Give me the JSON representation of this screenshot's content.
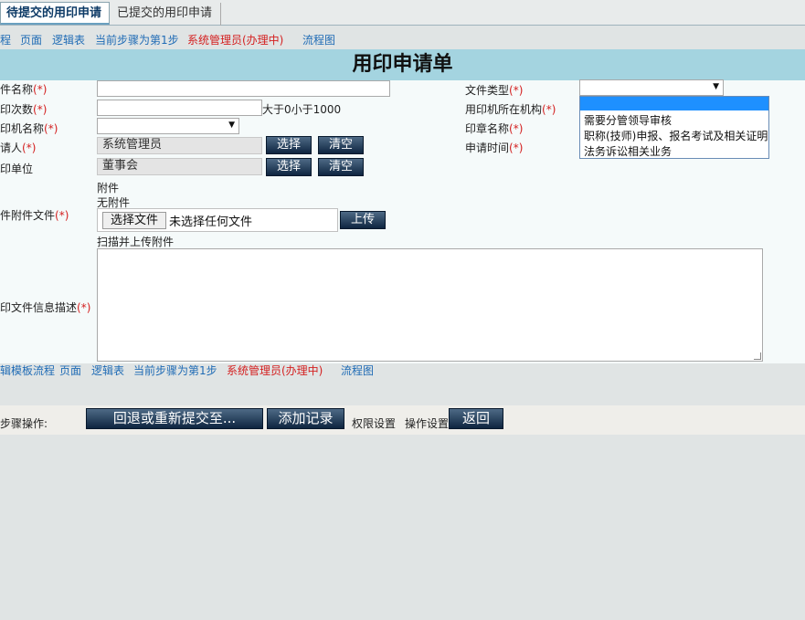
{
  "tabs": [
    {
      "label": "待提交的用印申请",
      "active": true
    },
    {
      "label": "已提交的用印申请",
      "active": false
    }
  ],
  "top_nav": {
    "items": [
      "程",
      "页面",
      "逻辑表",
      "当前步骤为第1步"
    ],
    "handler": "系统管理员(办理中)",
    "flowchart": "流程图"
  },
  "form": {
    "title": "用印申请单",
    "required_mark": "(*)",
    "fields": {
      "doc_name": {
        "label": "件名称"
      },
      "print_count": {
        "label": "印次数",
        "hint": "大于0小于1000"
      },
      "printer_name": {
        "label": "印机名称"
      },
      "applicant": {
        "label": "请人",
        "value": "系统管理员"
      },
      "unit": {
        "label": "印单位",
        "value": "董事会"
      },
      "attachment": {
        "label": "附件",
        "value": "无附件"
      },
      "attachment_file": {
        "label": "件附件文件",
        "choose_button": "选择文件",
        "no_file": "未选择任何文件",
        "upload_button": "上传",
        "scan_link": "扫描并上传附件"
      },
      "description": {
        "label": "印文件信息描述"
      },
      "doc_type": {
        "label": "文件类型",
        "options": [
          "",
          "需要分管领导审核",
          "职称(技师)申报、报名考试及相关证明",
          "法务诉讼相关业务"
        ]
      },
      "printer_org": {
        "label": "用印机所在机构"
      },
      "seal_name": {
        "label": "印章名称"
      },
      "apply_time": {
        "label": "申请时间"
      }
    },
    "select_button": "选择",
    "clear_button": "清空"
  },
  "bottom_nav": {
    "items": [
      "辑模板流程",
      "页面",
      "逻辑表",
      "当前步骤为第1步"
    ],
    "handler": "系统管理员(办理中)",
    "flowchart": "流程图"
  },
  "operations": {
    "label": "步骤操作:",
    "rollback_button": "回退或重新提交至...",
    "add_record_button": "添加记录",
    "permission_settings": "权限设置",
    "operation_settings": "操作设置",
    "back_button": "返回"
  }
}
